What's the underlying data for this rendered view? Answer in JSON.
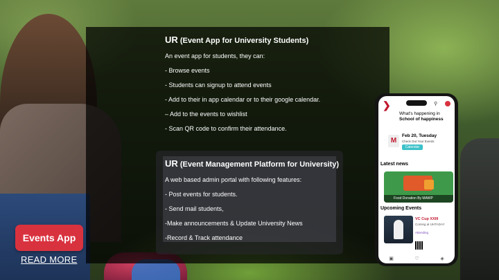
{
  "overlay": {
    "app_section": {
      "title_ur": "UR",
      "title_rest": "(Event  App for University Students)",
      "intro": "An event app for students, they can:",
      "items": [
        "- Browse events",
        "- Students can signup to attend events",
        "- Add to their in app calendar or to their google calendar.",
        "– Add to the events to wishlist",
        "- Scan  QR  code to confirm their attendance."
      ]
    },
    "admin_section": {
      "title_ur": "UR",
      "title_rest": "(Event Management Platform for University)",
      "intro": "A web based admin portal with following features:",
      "items": [
        "- Post events for students.",
        "- Send mail  students,",
        "-Make announcements & Update University News",
        " -Record & Track attendance"
      ]
    }
  },
  "cta": {
    "button_label": "Events App",
    "link_label": "READ MORE"
  },
  "phone": {
    "heading_line1": "What's happening in",
    "heading_line2": "School of happiness",
    "date_title": "Feb 20, Tuesday",
    "date_sub": "Check Out Your Events",
    "calendar_button": "Calendar",
    "latest_news": "Latest news",
    "news_caption": "Food Donation By MAWP",
    "upcoming_events": "Upcoming Events",
    "event_title": "VC Cup XXIII",
    "event_sub": "Coming at UHTADAY",
    "event_tag": "Attending",
    "colors": {
      "accent": "#c0182e",
      "button": "#d9323f",
      "calendar": "#3dc1c9"
    }
  }
}
